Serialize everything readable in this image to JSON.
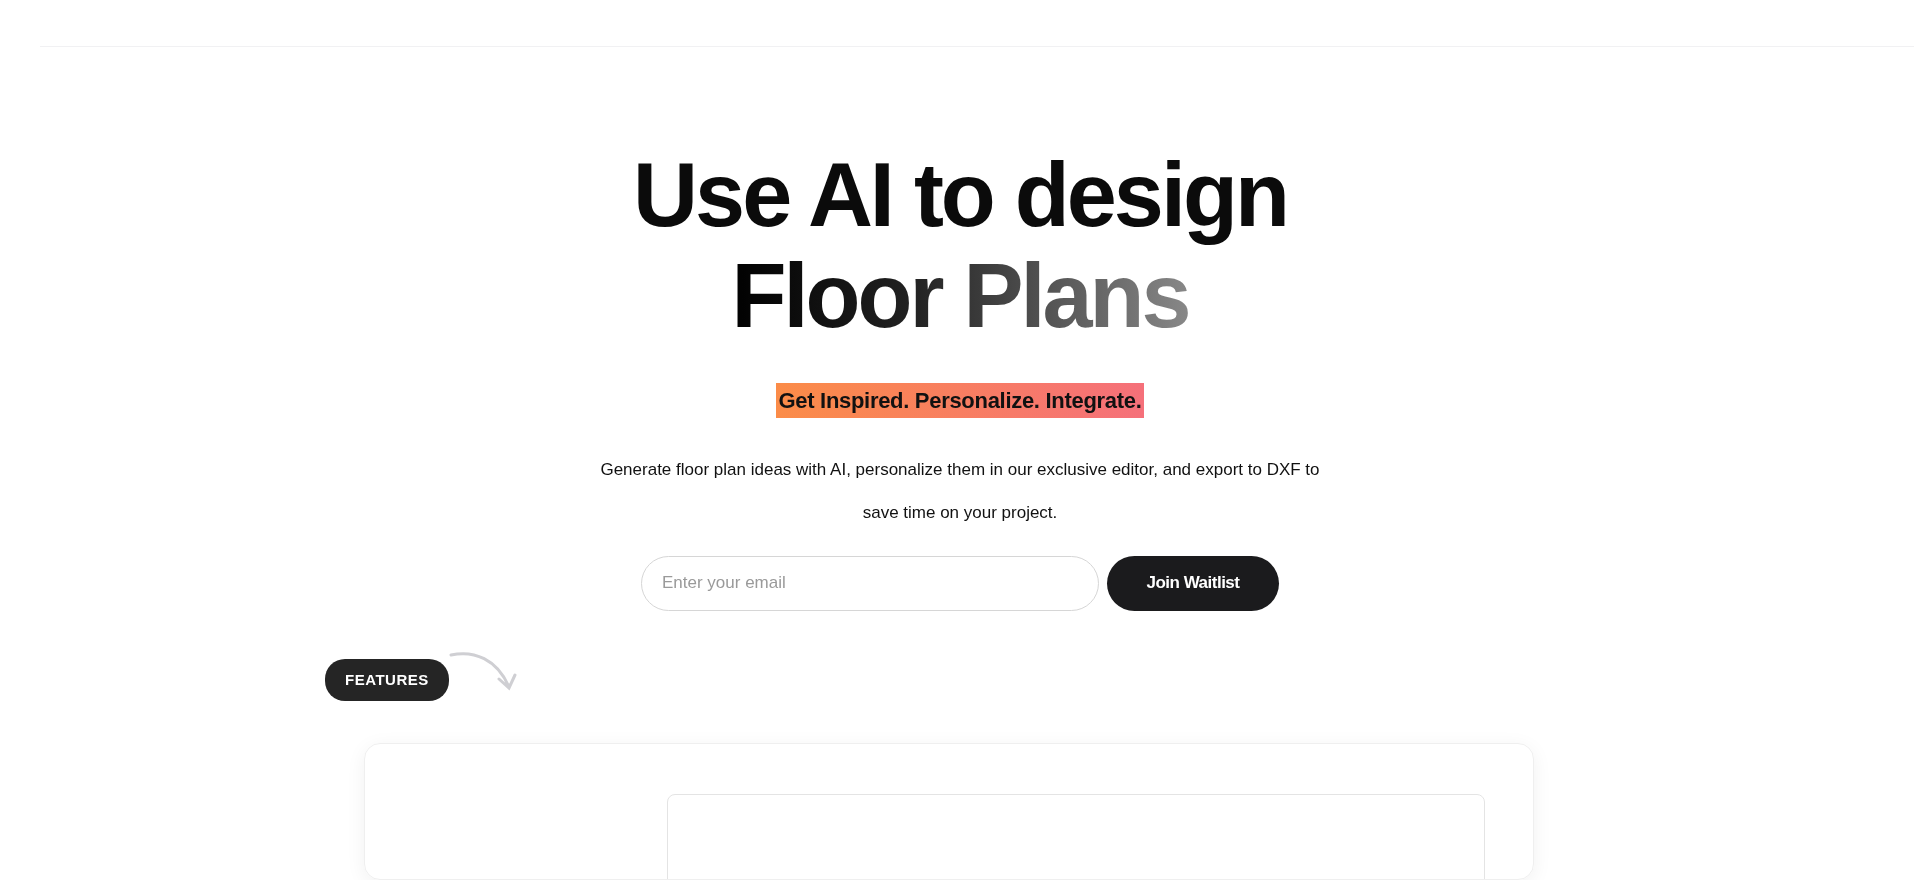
{
  "hero": {
    "title_lines": [
      "Use AI to design",
      "Floor Plans"
    ],
    "tagline": "Get Inspired. Personalize. Integrate.",
    "description": "Generate floor plan ideas with AI, personalize them in our exclusive editor, and export to DXF to save time on your project."
  },
  "signup": {
    "placeholder": "Enter your email",
    "button": "Join Waitlist"
  },
  "features": {
    "label": "FEATURES"
  }
}
